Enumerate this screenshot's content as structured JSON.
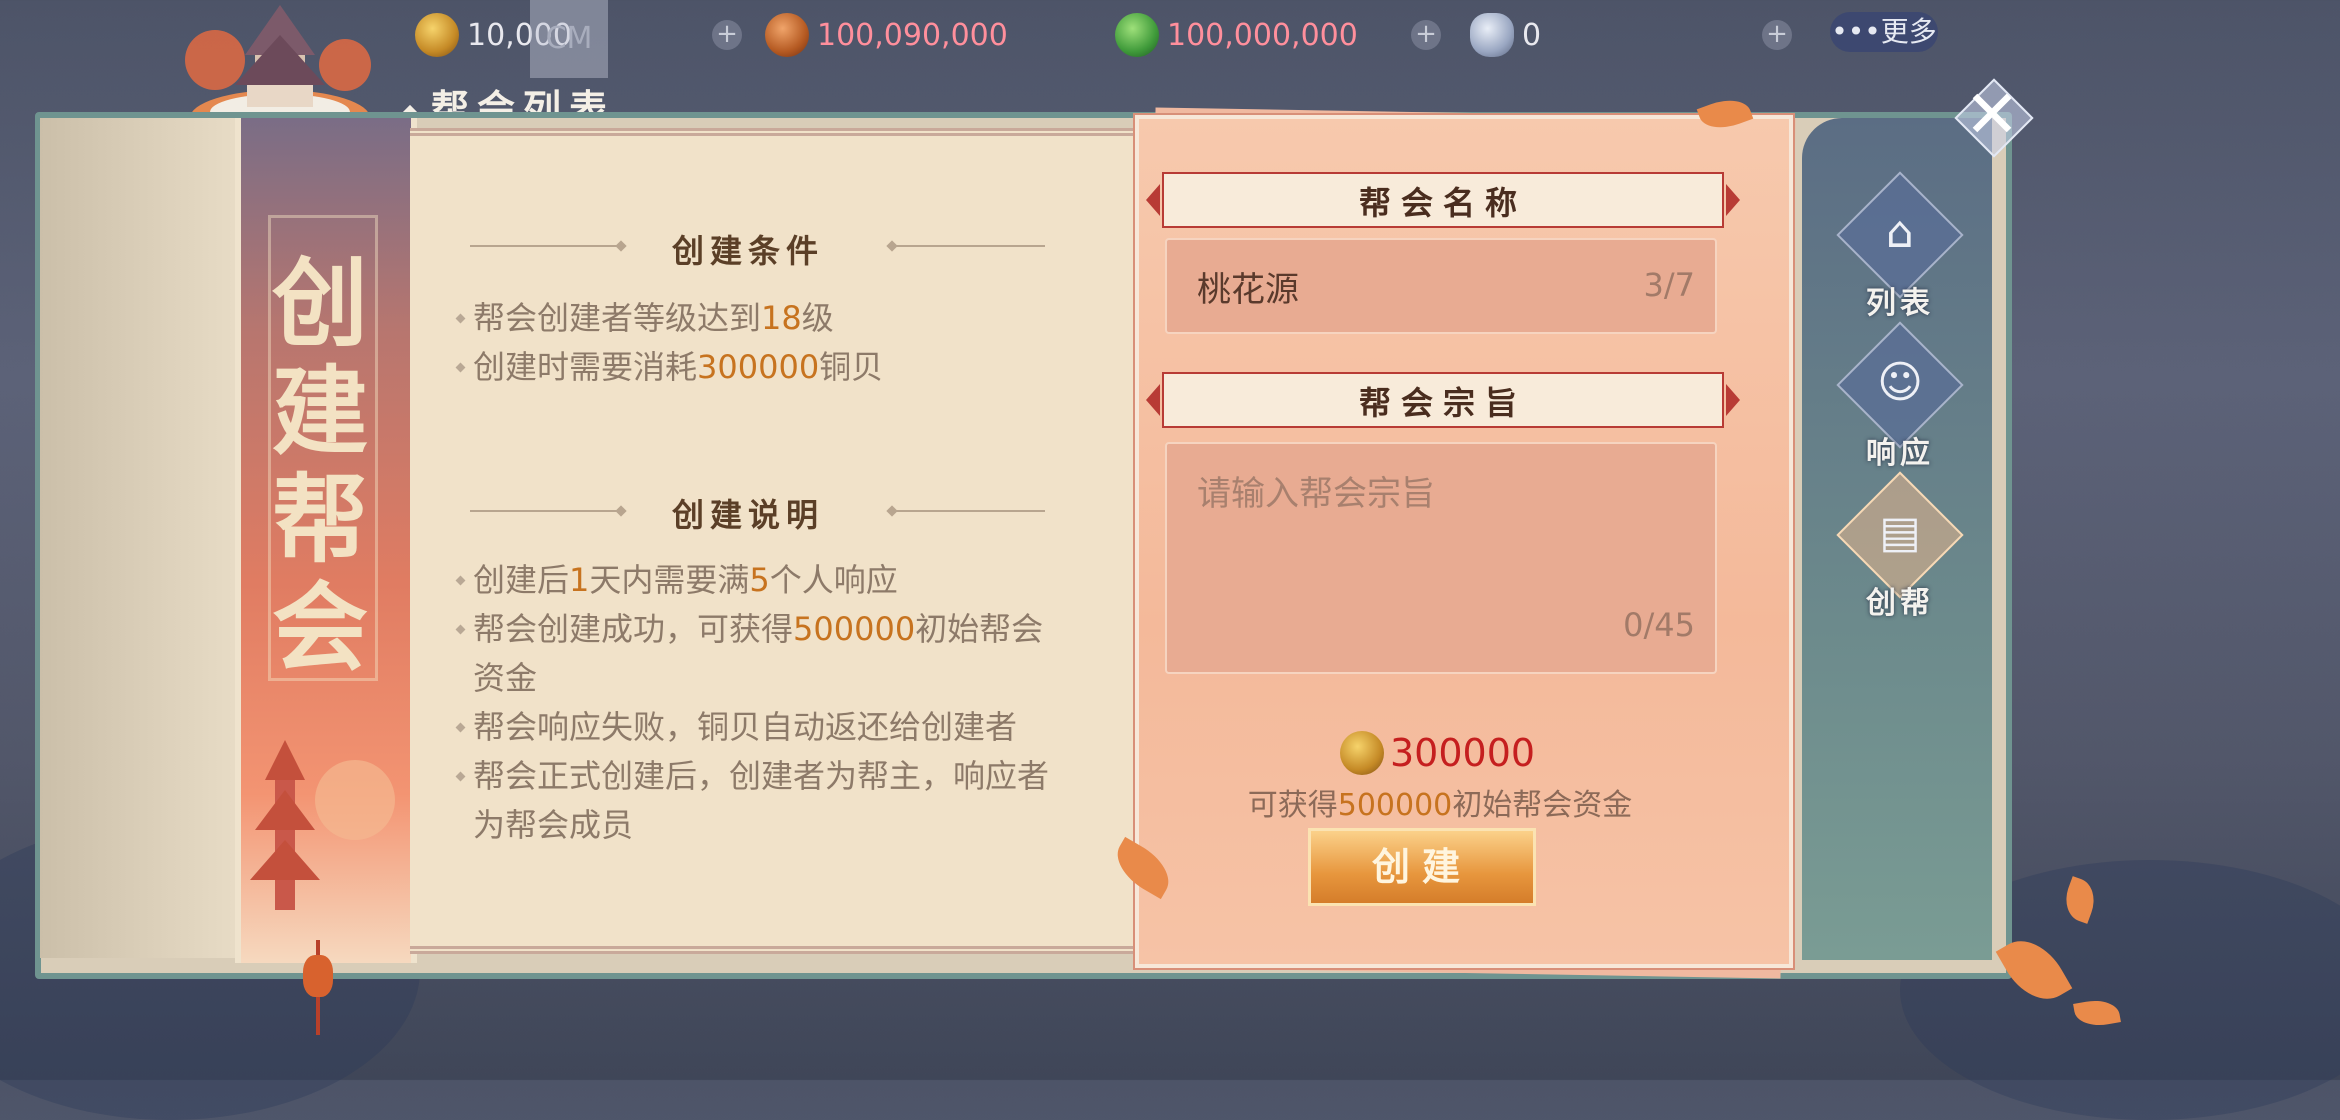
{
  "currencies": [
    {
      "icon": "gold-coin-icon",
      "value": "10,000"
    },
    {
      "icon": "copper-shell-icon",
      "value": "100,090,000"
    },
    {
      "icon": "jade-leaf-icon",
      "value": "100,000,000"
    },
    {
      "icon": "pearl-icon",
      "value": "0"
    }
  ],
  "overlay_cm": "CM",
  "more_label": "•••更多",
  "page_title": "帮会列表",
  "banner_title": "创建帮会",
  "conditions": {
    "heading": "创建条件",
    "items": [
      {
        "pre": "帮会创建者等级达到",
        "hl": "18",
        "post": "级"
      },
      {
        "pre": "创建时需要消耗",
        "hl": "300000",
        "post": "铜贝"
      }
    ]
  },
  "instructions": {
    "heading": "创建说明",
    "items": [
      {
        "pre": "创建后",
        "hl1": "1",
        "mid": "天内需要满",
        "hl2": "5",
        "post": "个人响应"
      },
      {
        "line1_pre": "帮会创建成功，可获得",
        "line1_hl": "500000",
        "line1_post": "初始帮会",
        "line2": "资金"
      },
      {
        "text": "帮会响应失败，铜贝自动返还给创建者"
      },
      {
        "line1": "帮会正式创建后，创建者为帮主，响应者",
        "line2": "为帮会成员"
      }
    ]
  },
  "form": {
    "name_label": "帮会名称",
    "name_value": "桃花源",
    "name_count": "3/7",
    "purpose_label": "帮会宗旨",
    "purpose_placeholder": "请输入帮会宗旨",
    "purpose_count": "0/45",
    "cost_value": "300000",
    "gain_pre": "可获得",
    "gain_hl": "500000",
    "gain_post": "初始帮会资金",
    "create_button": "创建"
  },
  "side_nav": [
    {
      "label": "列表",
      "icon": "pagoda-icon",
      "active": false
    },
    {
      "label": "响应",
      "icon": "people-icon",
      "active": false
    },
    {
      "label": "创帮",
      "icon": "book-pagoda-icon",
      "active": true
    }
  ],
  "colors": {
    "highlight": "#c7731f",
    "cost_red": "#c51f1f",
    "count_pink": "#ff8f9c"
  }
}
